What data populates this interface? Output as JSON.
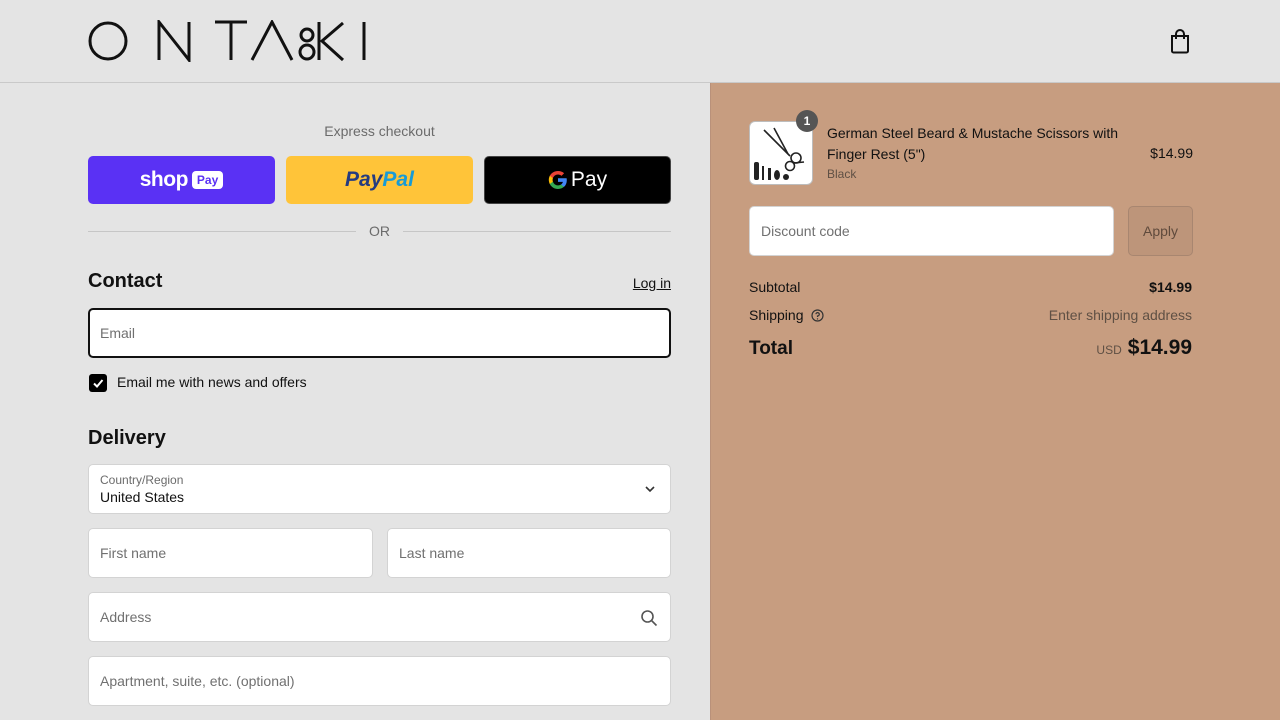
{
  "header": {
    "logo_text": "ONTAKI",
    "cart_icon": "shopping-bag-icon"
  },
  "express": {
    "title": "Express checkout",
    "shop_pay": {
      "label_shop": "shop",
      "label_pay": "Pay"
    },
    "paypal": {
      "label_pay": "Pay",
      "label_pal": "Pal"
    },
    "gpay": {
      "label": "Pay"
    },
    "or_label": "OR"
  },
  "contact": {
    "title": "Contact",
    "login_label": "Log in",
    "email_placeholder": "Email",
    "newsletter_label": "Email me with news and offers",
    "newsletter_checked": true
  },
  "delivery": {
    "title": "Delivery",
    "country_label": "Country/Region",
    "country_value": "United States",
    "first_name_placeholder": "First name",
    "last_name_placeholder": "Last name",
    "address_placeholder": "Address",
    "apartment_placeholder": "Apartment, suite, etc. (optional)"
  },
  "summary": {
    "product": {
      "name": "German Steel Beard & Mustache Scissors with Finger Rest (5\")",
      "variant": "Black",
      "price": "$14.99",
      "quantity": "1"
    },
    "discount_placeholder": "Discount code",
    "apply_label": "Apply",
    "subtotal_label": "Subtotal",
    "subtotal_value": "$14.99",
    "shipping_label": "Shipping",
    "shipping_value": "Enter shipping address",
    "total_label": "Total",
    "currency": "USD",
    "total_value": "$14.99"
  },
  "colors": {
    "shop_pay": "#5a31f4",
    "paypal": "#ffc439",
    "gpay": "#000000",
    "summary_bg": "#c79d80",
    "page_bg": "#e4e4e4"
  }
}
